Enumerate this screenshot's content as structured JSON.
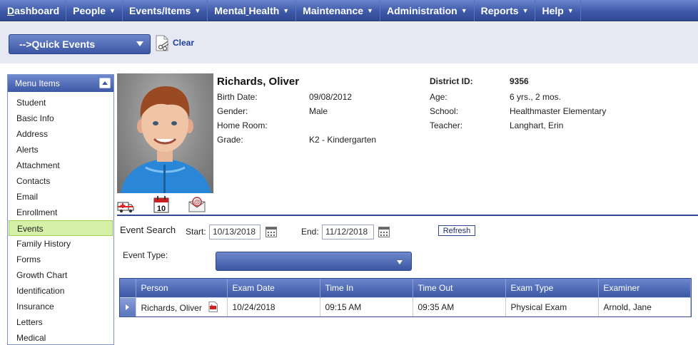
{
  "nav": {
    "items": [
      {
        "label_first": "D",
        "label_rest": "ashboard",
        "caret": ""
      },
      {
        "label": "People",
        "caret": "▼"
      },
      {
        "label": "Events/Items",
        "caret": "▼"
      },
      {
        "label_a": "Mental",
        "label_b": "Health",
        "caret": "▼"
      },
      {
        "label": "Maintenance",
        "caret": "▼"
      },
      {
        "label": "Administration",
        "caret": "▼"
      },
      {
        "label": "Reports",
        "caret": "▼"
      },
      {
        "label": "Help",
        "caret": "▼"
      }
    ]
  },
  "quick_events": {
    "selected": "-->Quick Events",
    "clear_label": "Clear"
  },
  "menu": {
    "title": "Menu Items",
    "items": [
      "Student",
      "Basic Info",
      "Address",
      "Alerts",
      "Attachment",
      "Contacts",
      "Email",
      "Enrollment",
      "Events",
      "Family History",
      "Forms",
      "Growth Chart",
      "Identification",
      "Insurance",
      "Letters",
      "Medical"
    ],
    "active": "Events"
  },
  "student": {
    "name": "Richards, Oliver",
    "birth_date_label": "Birth Date:",
    "birth_date": "09/08/2012",
    "gender_label": "Gender:",
    "gender": "Male",
    "home_room_label": "Home Room:",
    "home_room": "",
    "grade_label": "Grade:",
    "grade": "K2 - Kindergarten",
    "district_id_label": "District ID:",
    "district_id": "9356",
    "age_label": "Age:",
    "age": "6 yrs., 2 mos.",
    "school_label": "School:",
    "school": "Healthmaster Elementary",
    "teacher_label": "Teacher:",
    "teacher": "Langhart, Erin"
  },
  "calendar_icon_day": "10",
  "event_search": {
    "title": "Event Search",
    "start_label": "Start:",
    "start_value": "10/13/2018",
    "end_label": "End:",
    "end_value": "11/12/2018",
    "refresh_label": "Refresh",
    "event_type_label": "Event Type:",
    "event_type_value": ""
  },
  "table": {
    "columns": [
      "Person",
      "Exam Date",
      "Time In",
      "Time Out",
      "Exam Type",
      "Examiner"
    ],
    "rows": [
      {
        "person": "Richards, Oliver",
        "exam_date": "10/24/2018",
        "time_in": "09:15 AM",
        "time_out": "09:35 AM",
        "exam_type": "Physical Exam",
        "examiner": "Arnold, Jane"
      }
    ]
  }
}
